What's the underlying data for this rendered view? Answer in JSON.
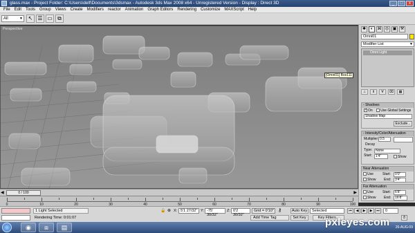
{
  "window": {
    "title": "glass.max    - Project Folder: C:\\Users\\delf\\Documents\\3dsmax     - Autodesk 3ds Max 2008 x64     - Unregistered Version     - Display : Direct 3D",
    "minimize": "_",
    "maximize": "□",
    "close": "x"
  },
  "menu": [
    "File",
    "Edit",
    "Tools",
    "Group",
    "Views",
    "Create",
    "Modifiers",
    "reactor",
    "Animation",
    "Graph Editors",
    "Rendering",
    "Customize",
    "MAXScript",
    "Help"
  ],
  "toolbar": {
    "selection_filter": "All",
    "tools": [
      {
        "name": "select-object-icon",
        "glyph": "↖"
      },
      {
        "name": "select-by-name-icon",
        "glyph": "☰"
      },
      {
        "name": "rect-selection-region-icon",
        "glyph": "▭"
      },
      {
        "name": "window-crossing-icon",
        "glyph": "⧉"
      }
    ]
  },
  "viewport": {
    "label": "Perspective",
    "tooltip": "[Omni01] Box111"
  },
  "command_panel": {
    "tabs": [
      {
        "name": "create-tab-icon",
        "glyph": "✱"
      },
      {
        "name": "modify-tab-icon",
        "glyph": "◐"
      },
      {
        "name": "hierarchy-tab-icon",
        "glyph": "⌘"
      },
      {
        "name": "motion-tab-icon",
        "glyph": "◎"
      },
      {
        "name": "display-tab-icon",
        "glyph": "▣"
      },
      {
        "name": "utilities-tab-icon",
        "glyph": "⚒"
      }
    ],
    "object_name": "Omni01",
    "object_color": "#ffe400",
    "modifier_list": "Modifier List",
    "stack_item": "Omni Light",
    "shadows": {
      "title": "Shadows",
      "on_label": "On",
      "on_checked": "✓",
      "use_global": "Use Global Settings",
      "type": "Shadow Map",
      "exclude": "Exclude..."
    },
    "intensity": {
      "title": "Intensity/Color/Attenuation",
      "multiplier_label": "Multiplier:",
      "multiplier": "0.5",
      "decay_title": "Decay",
      "type_label": "Type:",
      "type": "None",
      "start_label": "Start:",
      "start": "1'4\"",
      "show_label": "Show"
    },
    "near_atten": {
      "title": "Near Attenuation",
      "use": "Use",
      "show": "Show",
      "start_label": "Start:",
      "start": "0'0\"",
      "end_label": "End:",
      "end": "3'4\""
    },
    "far_atten": {
      "title": "Far Attenuation",
      "use": "Use",
      "show": "Show",
      "start_label": "Start:",
      "start": "6'8\"",
      "end_label": "End:",
      "end": "16'8\""
    }
  },
  "timeline": {
    "slider": "0 / 100",
    "tick_labels": [
      "0",
      "10",
      "20",
      "30",
      "40",
      "50",
      "60",
      "70",
      "80",
      "90",
      "100"
    ]
  },
  "status": {
    "selection": "1 Light Selected",
    "render_time": "Rendering Time: 0:01:07",
    "x_label": "X:",
    "x": "5'1 27/32\"",
    "y_label": "Y:",
    "y": "-75' 30/32\"",
    "z_label": "Z:",
    "z": "0'2 30/32\"",
    "grid": "Grid = 0'10\"",
    "add_time_tag": "Add Time Tag",
    "auto_key": "Auto Key",
    "set_key": "Set Key",
    "key_mode": "Selected",
    "key_filters": "Key Filters...",
    "frame": "0"
  },
  "taskbar": {
    "apps": [
      {
        "name": "chrome-taskbar-icon",
        "glyph": "◉"
      },
      {
        "name": "3dsmax-taskbar-icon",
        "glyph": "⧈"
      },
      {
        "name": "explorer-taskbar-icon",
        "glyph": "▤"
      }
    ],
    "clock": "26-AUG-09"
  },
  "watermark": "pxleyes.com"
}
